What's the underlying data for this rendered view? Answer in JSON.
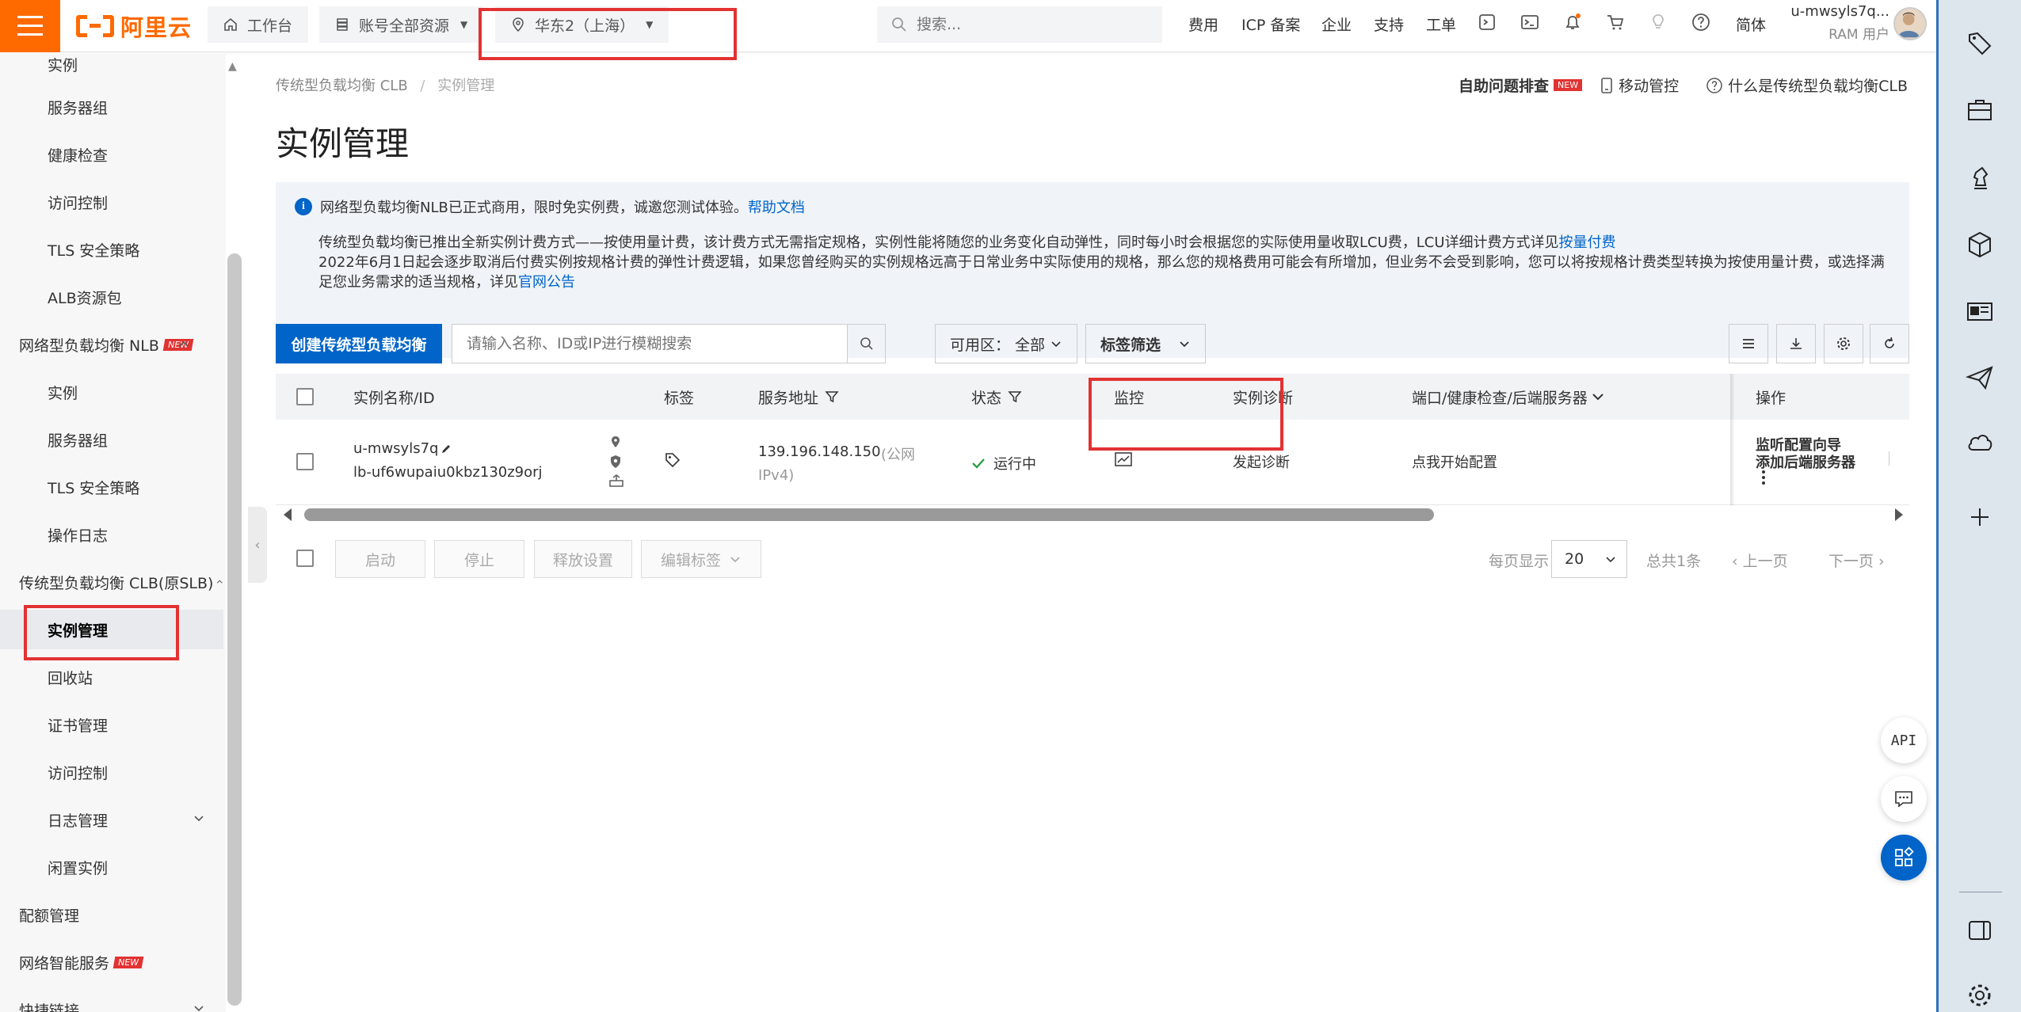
{
  "header": {
    "logo_text": "阿里云",
    "workbench": "工作台",
    "account_scope": "账号全部资源",
    "region": "华东2（上海）",
    "search_placeholder": "搜索...",
    "nav": [
      "费用",
      "ICP 备案",
      "企业",
      "支持",
      "工单"
    ],
    "lang": "简体",
    "user_name": "u-mwsyls7q...",
    "user_role": "RAM 用户"
  },
  "sidebar": {
    "items": [
      {
        "label": "实例",
        "type": "sub"
      },
      {
        "label": "服务器组",
        "type": "sub"
      },
      {
        "label": "健康检查",
        "type": "sub"
      },
      {
        "label": "访问控制",
        "type": "sub"
      },
      {
        "label": "TLS 安全策略",
        "type": "sub"
      },
      {
        "label": "ALB资源包",
        "type": "sub"
      },
      {
        "label": "网络型负载均衡 NLB",
        "type": "group",
        "badge": "NEW"
      },
      {
        "label": "实例",
        "type": "sub"
      },
      {
        "label": "服务器组",
        "type": "sub"
      },
      {
        "label": "TLS 安全策略",
        "type": "sub"
      },
      {
        "label": "操作日志",
        "type": "sub"
      },
      {
        "label": "传统型负载均衡 CLB(原SLB)",
        "type": "group"
      },
      {
        "label": "实例管理",
        "type": "sub",
        "active": true
      },
      {
        "label": "回收站",
        "type": "sub"
      },
      {
        "label": "证书管理",
        "type": "sub"
      },
      {
        "label": "访问控制",
        "type": "sub"
      },
      {
        "label": "日志管理",
        "type": "sub"
      },
      {
        "label": "闲置实例",
        "type": "sub"
      },
      {
        "label": "配额管理",
        "type": "group"
      },
      {
        "label": "网络智能服务",
        "type": "group",
        "badge": "NEW"
      },
      {
        "label": "快捷链接",
        "type": "group"
      }
    ]
  },
  "breadcrumb": {
    "parent": "传统型负载均衡 CLB",
    "sep": "/",
    "current": "实例管理"
  },
  "top_links": {
    "diagnose": "自助问题排查",
    "diagnose_badge": "NEW",
    "mobile": "移动管控",
    "what_is": "什么是传统型负载均衡CLB"
  },
  "page_title": "实例管理",
  "notice": {
    "line1": "网络型负载均衡NLB已正式商用，限时免实例费，诚邀您测试体验。",
    "line1_link": "帮助文档",
    "line2": "传统型负载均衡已推出全新实例计费方式——按使用量计费，该计费方式无需指定规格，实例性能将随您的业务变化自动弹性，同时每小时会根据您的实际使用量收取LCU费，LCU详细计费方式详见",
    "line2_link": "按量付费",
    "line3": "2022年6月1日起会逐步取消后付费实例按规格计费的弹性计费逻辑，如果您曾经购买的实例规格远高于日常业务中实际使用的规格，那么您的规格费用可能会有所增加，但业务不会受到影响，您可以将按规格计费类型转换为按使用量计费，或选择满足您业务需求的适当规格，详见",
    "line3_link": "官网公告"
  },
  "toolbar": {
    "create": "创建传统型负载均衡",
    "search_placeholder": "请输入名称、ID或IP进行模糊搜索",
    "zone_label": "可用区：",
    "zone_value": "全部",
    "tag_filter": "标签筛选"
  },
  "table": {
    "headers": {
      "name": "实例名称/ID",
      "tags": "标签",
      "address": "服务地址",
      "status": "状态",
      "monitor": "监控",
      "diagnosis": "实例诊断",
      "port": "端口/健康检查/后端服务器",
      "ops": "操作"
    },
    "row": {
      "name": "u-mwsyls7q",
      "id": "lb-uf6wupaiu0kbz130z9orj",
      "ip": "139.196.148.150",
      "ip_type_1": "(公网",
      "ip_type_2": "IPv4)",
      "status": "运行中",
      "diagnose": "发起诊断",
      "port_action": "点我开始配置",
      "op1": "监听配置向导",
      "op2": "添加后端服务器"
    }
  },
  "bottom": {
    "start": "启动",
    "stop": "停止",
    "release": "释放设置",
    "edit_tags": "编辑标签",
    "per_page_label": "每页显示",
    "per_page": "20",
    "total": "总共1条",
    "prev": "上一页",
    "next": "下一页"
  },
  "float": {
    "api": "API"
  }
}
